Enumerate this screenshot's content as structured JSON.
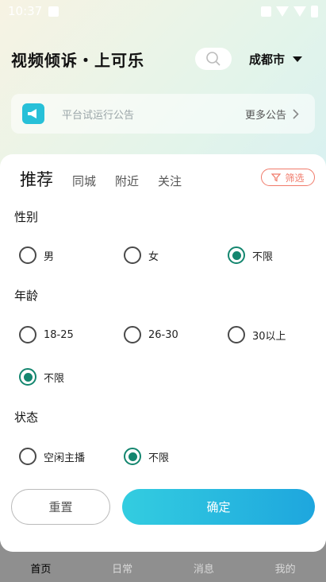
{
  "status_bar": {
    "time": "10:37"
  },
  "header": {
    "title": "视频倾诉・上可乐",
    "city": "成都市"
  },
  "notice": {
    "text": "平台试运行公告",
    "more": "更多公告"
  },
  "bottom_nav": [
    "首页",
    "日常",
    "消息",
    "我的"
  ],
  "filter": {
    "tabs": [
      "推荐",
      "同城",
      "附近",
      "关注"
    ],
    "filter_label": "筛选",
    "gender": {
      "title": "性别",
      "options": [
        "男",
        "女",
        "不限"
      ],
      "selected": "不限"
    },
    "age": {
      "title": "年龄",
      "options": [
        "18-25",
        "26-30",
        "30以上",
        "不限"
      ],
      "selected": "不限"
    },
    "status": {
      "title": "状态",
      "options": [
        "空闲主播",
        "不限"
      ],
      "selected": "不限"
    },
    "reset_label": "重置",
    "confirm_label": "确定"
  },
  "colors": {
    "accent": "#14866f",
    "confirm_start": "#33cde0",
    "confirm_end": "#1ea6de",
    "filter_red": "#f07a6a"
  }
}
